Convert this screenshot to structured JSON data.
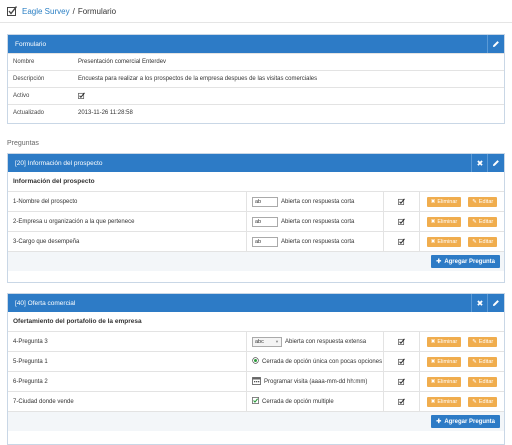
{
  "header": {
    "home_link": "Eagle Survey",
    "separator": "/",
    "current": "Formulario"
  },
  "form_panel": {
    "title": "Formulario",
    "rows": [
      {
        "label": "Nombre",
        "value": "Presentación comercial Enterdev"
      },
      {
        "label": "Descripción",
        "value": "Encuesta para realizar a los prospectos de la empresa despues de las visitas comerciales"
      },
      {
        "label": "Activo",
        "value": ""
      },
      {
        "label": "Actualizado",
        "value": "2013-11-26 11:28:58"
      }
    ]
  },
  "questions_label": "Preguntas",
  "sections": [
    {
      "title": "[20] Información del prospecto",
      "subtitle": "Información del prospecto",
      "questions": [
        {
          "name": "1-Nombre del prospecto",
          "type_icon": "ab",
          "type": "Abierta con respuesta corta"
        },
        {
          "name": "2-Empresa u organización a la que pertenece",
          "type_icon": "ab",
          "type": "Abierta con respuesta corta"
        },
        {
          "name": "3-Cargo que desempeña",
          "type_icon": "ab",
          "type": "Abierta con respuesta corta"
        }
      ],
      "add_label": "Agregar Pregunta"
    },
    {
      "title": "[40] Oferta comercial",
      "subtitle": "Ofertamiento del portafolio de la empresa",
      "questions": [
        {
          "name": "4-Pregunta 3",
          "type_icon": "abc",
          "type": "Abierta con respuesta extensa"
        },
        {
          "name": "5-Pregunta 1",
          "type_icon": "radio",
          "type": "Cerrada de opción única con pocas opciones"
        },
        {
          "name": "6-Pregunta 2",
          "type_icon": "calendar",
          "type": "Programar visita (aaaa-mm-dd hh:mm)"
        },
        {
          "name": "7-Ciudad donde vende",
          "type_icon": "checkbox",
          "type": "Cerrada de opción multiple"
        }
      ],
      "add_label": "Agregar Pregunta"
    }
  ],
  "buttons": {
    "delete": "Eliminar",
    "edit": "Editar"
  },
  "colors": {
    "primary": "#2d7bc6",
    "warning": "#f0ad4e",
    "link": "#2a7fc4"
  }
}
